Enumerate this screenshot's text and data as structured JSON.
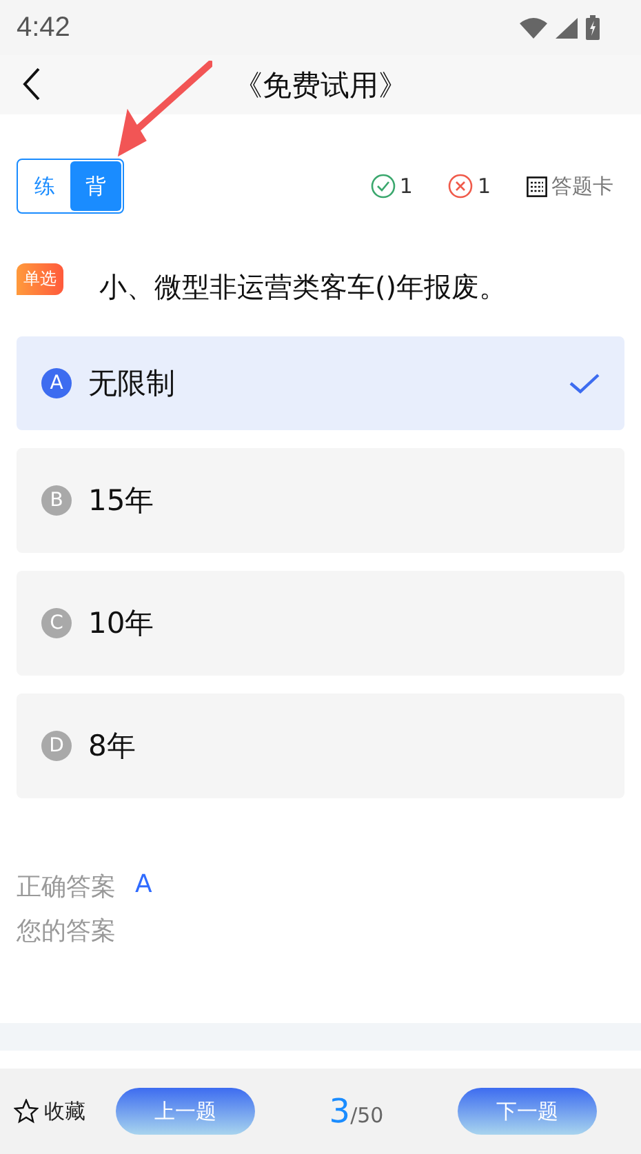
{
  "status_bar": {
    "time": "4:42"
  },
  "header": {
    "title": "《免费试用》"
  },
  "mode_toggle": [
    {
      "label": "练",
      "selected": false
    },
    {
      "label": "背",
      "selected": true
    }
  ],
  "stats": {
    "correct": "1",
    "wrong": "1",
    "answer_card": "答题卡"
  },
  "question": {
    "type_badge": "单选",
    "text": "小、微型非运营类客车()年报废。"
  },
  "options": [
    {
      "letter": "A",
      "text": "无限制",
      "selected": true
    },
    {
      "letter": "B",
      "text": "15年",
      "selected": false
    },
    {
      "letter": "C",
      "text": "10年",
      "selected": false
    },
    {
      "letter": "D",
      "text": "8年",
      "selected": false
    }
  ],
  "answer": {
    "correct_label": "正确答案",
    "correct_value": "A",
    "yours_label": "您的答案"
  },
  "footer": {
    "favorite": "收藏",
    "prev": "上一题",
    "current": "3",
    "total": "/50",
    "next": "下一题"
  }
}
